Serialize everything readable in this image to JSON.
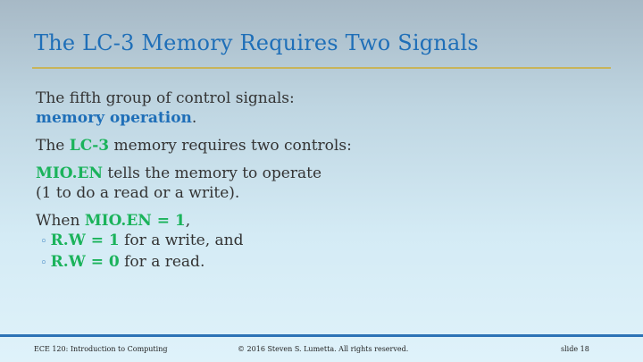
{
  "slide": {
    "title": "The LC-3 Memory Requires Two Signals",
    "p1_line1": "The fifth group of control signals:",
    "p1_hl": "memory operation",
    "p1_end": ".",
    "p2_pre": "The ",
    "p2_hl": "LC-3",
    "p2_post": " memory requires two controls:",
    "p3_hl": "MIO.EN",
    "p3_post": " tells the memory to operate",
    "p3_line2": "(1 to do a read or a write).",
    "p4_pre": "When ",
    "p4_hl": "MIO.EN = 1",
    "p4_post": ",",
    "bullets": [
      {
        "mark": "◦",
        "hl": "R.W = 1",
        "text": " for a write, and"
      },
      {
        "mark": "◦",
        "hl": "R.W = 0",
        "text": " for a read."
      }
    ]
  },
  "footer": {
    "course": "ECE 120: Introduction to Computing",
    "copyright": "© 2016 Steven S. Lumetta.  All rights reserved.",
    "slide_number": "slide 18"
  },
  "colors": {
    "title": "#1f6fb8",
    "highlight_blue": "#1f6fb8",
    "highlight_green": "#1bb35b",
    "title_rule": "#c8b45a",
    "footer_rule": "#2d73b6"
  }
}
